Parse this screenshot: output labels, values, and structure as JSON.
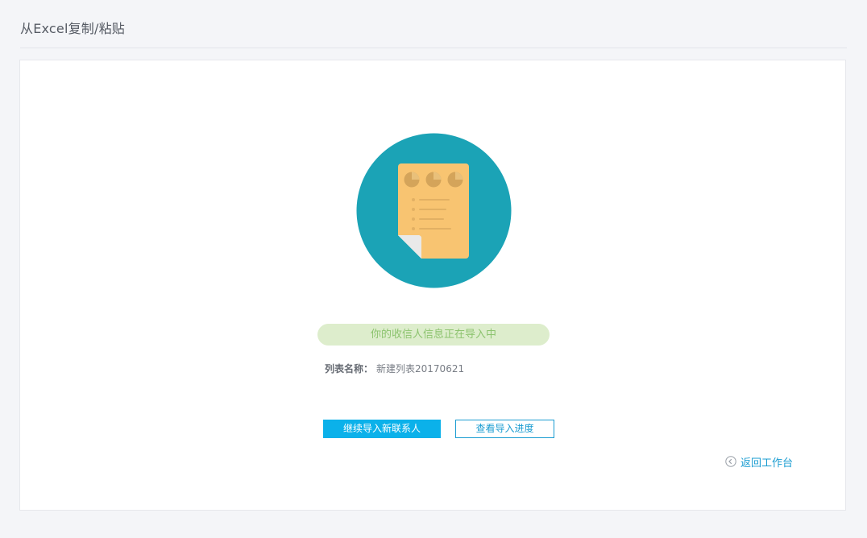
{
  "header": {
    "title": "从Excel复制/粘贴"
  },
  "status": {
    "message": "你的收信人信息正在导入中"
  },
  "list": {
    "label": "列表名称：",
    "value": "新建列表20170621"
  },
  "actions": {
    "continue_label": "继续导入新联系人",
    "progress_label": "查看导入进度"
  },
  "nav": {
    "back_label": "返回工作台",
    "back_icon": "chevron-left-circle-icon"
  },
  "colors": {
    "accent": "#0bb1ea",
    "link": "#1a9cd1",
    "illustration_circle": "#1ba3b6",
    "document": "#f8c471",
    "status_bg": "#ddedcc",
    "status_text": "#8cc36e"
  }
}
